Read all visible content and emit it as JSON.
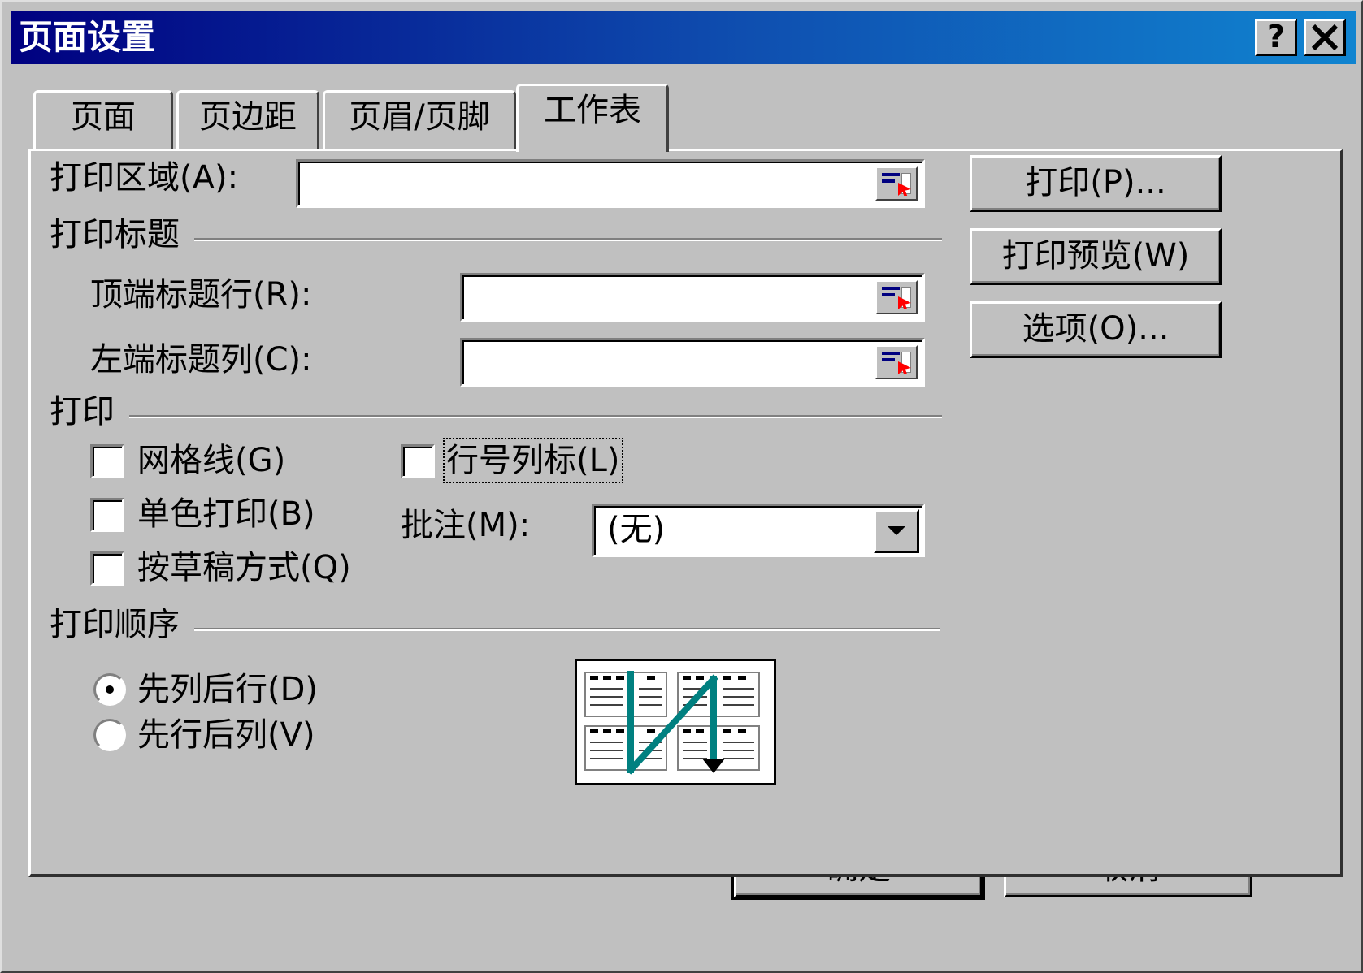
{
  "window": {
    "title": "页面设置",
    "help_label": "?",
    "close_label": "✕"
  },
  "tabs": [
    {
      "label": "页面",
      "active": false
    },
    {
      "label": "页边距",
      "active": false
    },
    {
      "label": "页眉/页脚",
      "active": false
    },
    {
      "label": "工作表",
      "active": true
    }
  ],
  "sheet": {
    "print_area_label": "打印区域(A):",
    "print_area_value": "",
    "print_titles_heading": "打印标题",
    "top_rows_label": "顶端标题行(R):",
    "top_rows_value": "",
    "left_columns_label": "左端标题列(C):",
    "left_columns_value": "",
    "print_heading": "打印",
    "gridlines_label": "网格线(G)",
    "gridlines_checked": false,
    "row_col_headers_label": "行号列标(L)",
    "row_col_headers_checked": false,
    "black_white_label": "单色打印(B)",
    "black_white_checked": false,
    "draft_label": "按草稿方式(Q)",
    "draft_checked": false,
    "comments_label": "批注(M):",
    "comments_value": "(无)",
    "order_heading": "打印顺序",
    "down_then_over_label": "先列后行(D)",
    "down_then_over_selected": true,
    "over_then_down_label": "先行后列(V)",
    "over_then_down_selected": false
  },
  "side_buttons": {
    "print": "打印(P)...",
    "print_preview": "打印预览(W)",
    "options": "选项(O)..."
  },
  "footer": {
    "ok": "确定",
    "cancel": "取消"
  },
  "colors": {
    "title_start": "#000080",
    "title_end": "#1084d0",
    "face": "#c0c0c0",
    "arrow": "#008080"
  }
}
